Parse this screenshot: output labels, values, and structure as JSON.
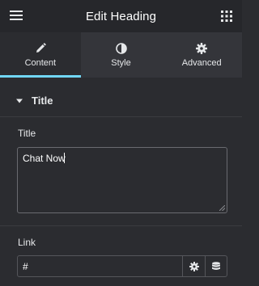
{
  "header": {
    "title": "Edit Heading",
    "menu_icon": "hamburger-menu-icon",
    "apps_icon": "grid-icon"
  },
  "tabs": [
    {
      "label": "Content",
      "icon": "pencil-icon",
      "active": true
    },
    {
      "label": "Style",
      "icon": "half-circle-icon",
      "active": false
    },
    {
      "label": "Advanced",
      "icon": "gear-icon",
      "active": false
    }
  ],
  "section": {
    "title": "Title",
    "expanded": true
  },
  "title_field": {
    "label": "Title",
    "value": "Chat Now"
  },
  "link_field": {
    "label": "Link",
    "value": "#"
  },
  "colors": {
    "accent": "#71d7f7",
    "panel_bg": "#2b2c30",
    "header_bg": "#26272b",
    "tabs_bg": "#34353a"
  }
}
